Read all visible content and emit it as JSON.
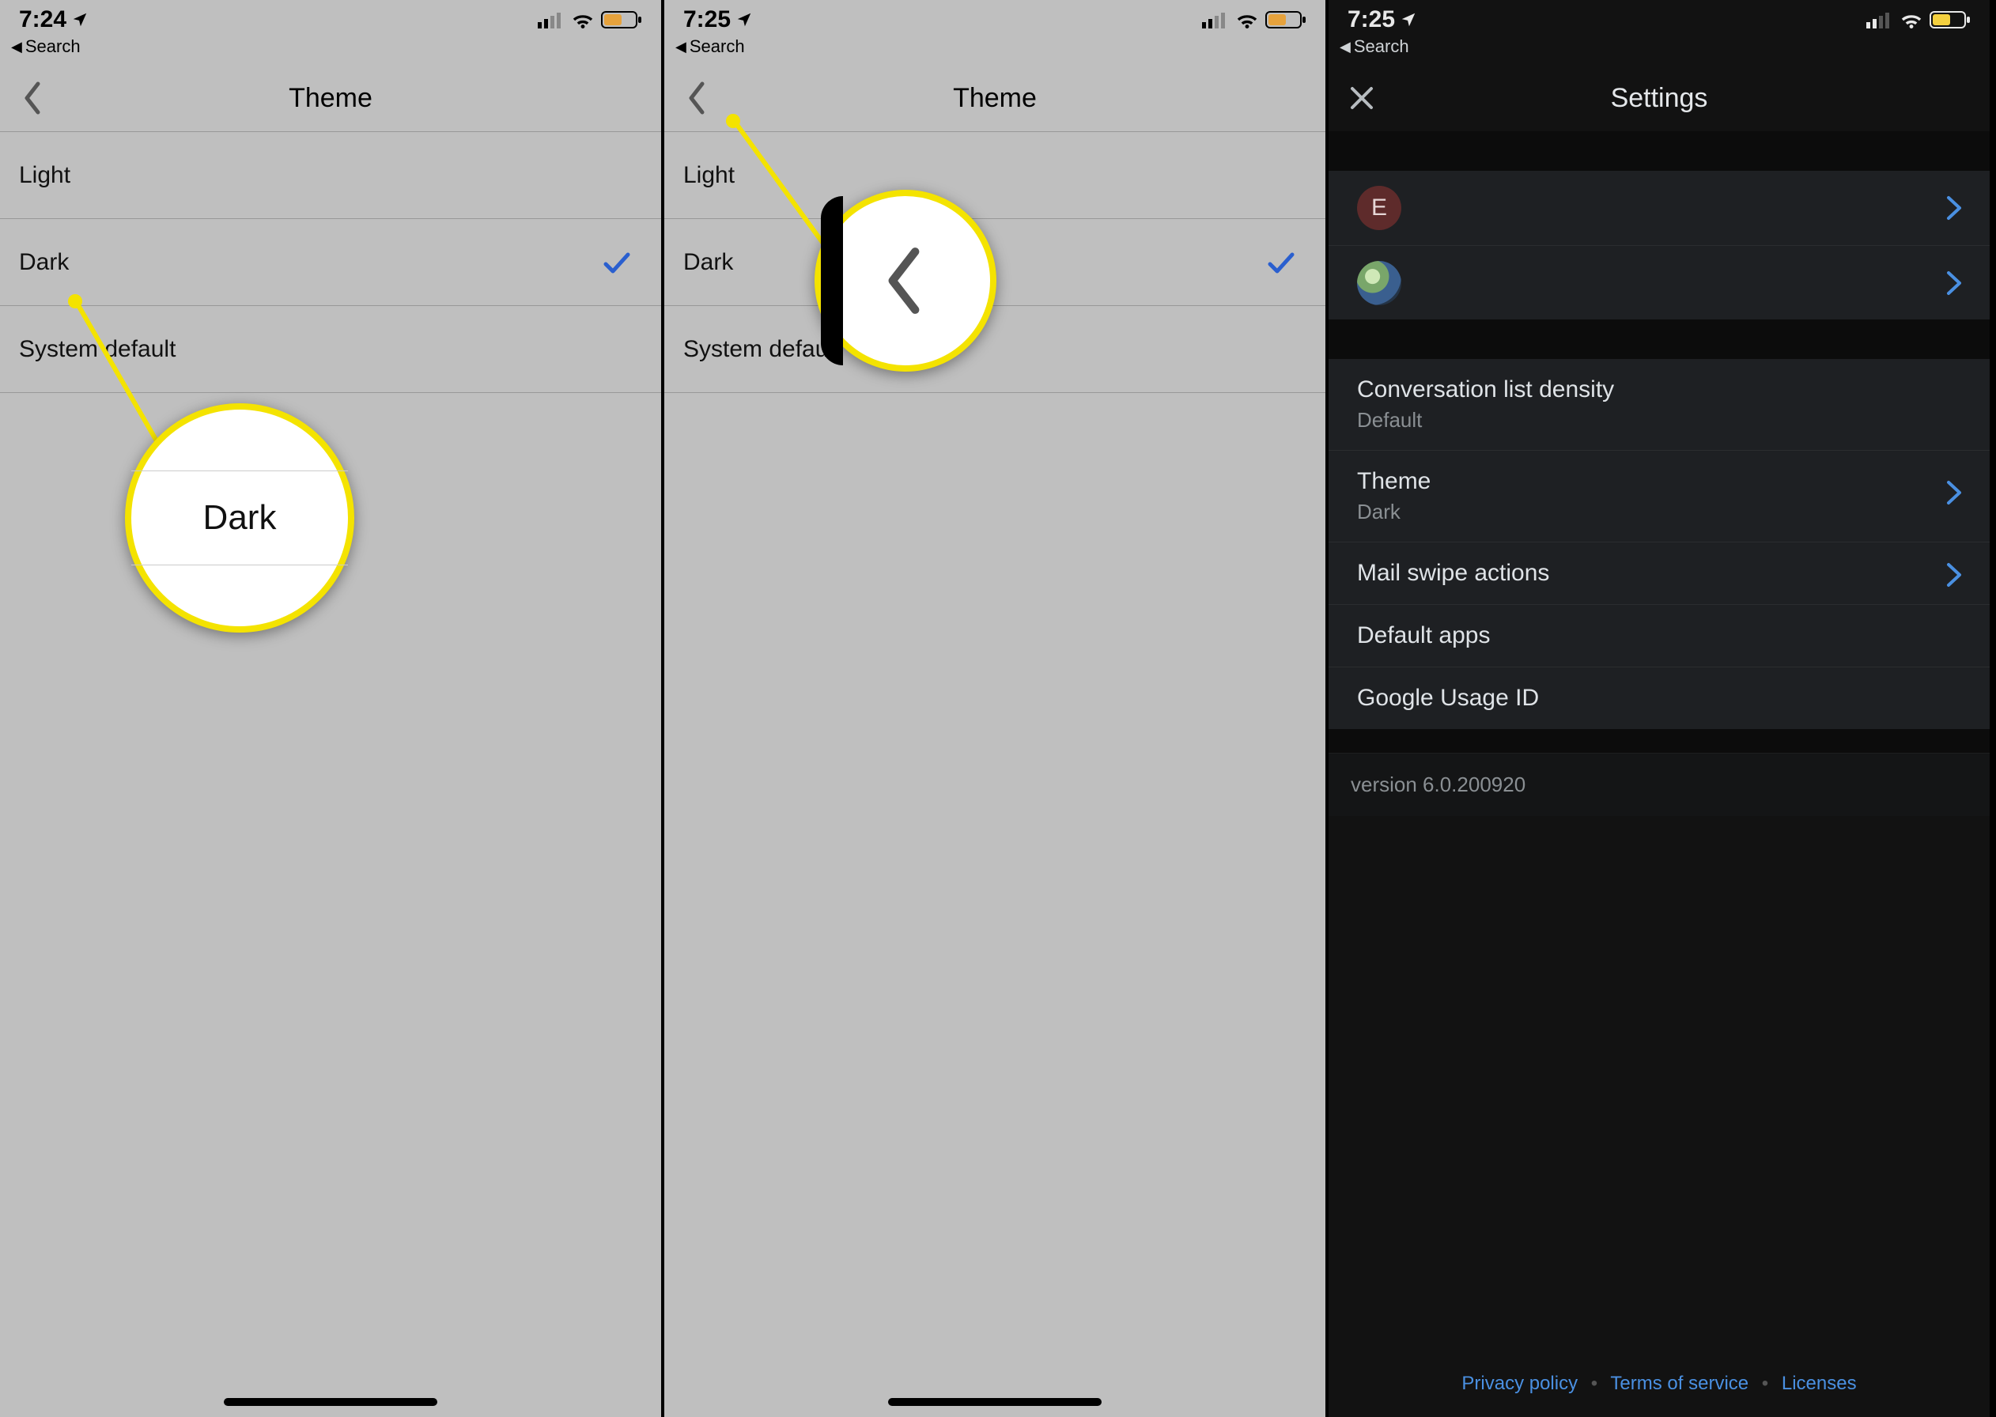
{
  "screens": {
    "a": {
      "time": "7:24",
      "back_crumb": "Search",
      "title": "Theme",
      "options": {
        "light": "Light",
        "dark": "Dark",
        "system": "System default"
      },
      "selected": "dark",
      "callout_label": "Dark"
    },
    "b": {
      "time": "7:25",
      "back_crumb": "Search",
      "title": "Theme",
      "options": {
        "light": "Light",
        "dark": "Dark",
        "system": "System default"
      },
      "selected": "dark"
    },
    "c": {
      "time": "7:25",
      "back_crumb": "Search",
      "title": "Settings",
      "accounts": [
        {
          "kind": "letter",
          "letter": "E"
        },
        {
          "kind": "photo"
        }
      ],
      "rows": {
        "density_label": "Conversation list density",
        "density_value": "Default",
        "theme_label": "Theme",
        "theme_value": "Dark",
        "swipe_label": "Mail swipe actions",
        "default_apps_label": "Default apps",
        "usage_id_label": "Google Usage ID"
      },
      "version": "version 6.0.200920",
      "footer": {
        "privacy": "Privacy policy",
        "terms": "Terms of service",
        "licenses": "Licenses"
      }
    }
  }
}
